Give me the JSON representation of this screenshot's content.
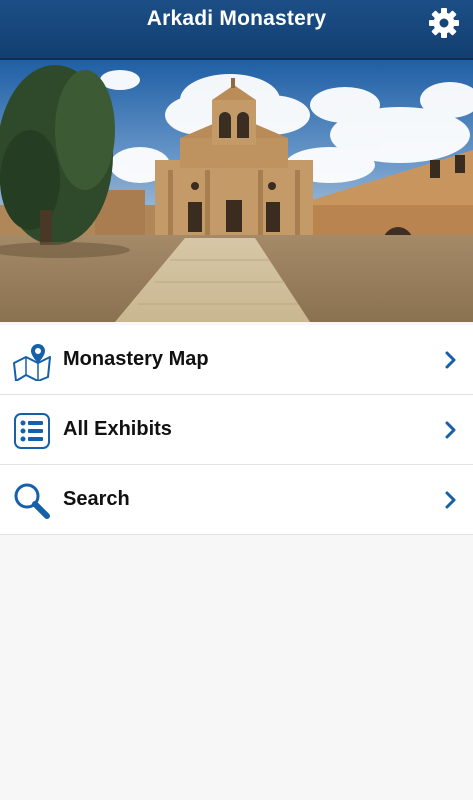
{
  "header": {
    "title": "Arkadi Monastery",
    "settings_icon": "gear-icon"
  },
  "hero": {
    "image_subject": "Arkadi Monastery church facade under blue sky with clouds, cypress tree and courtyard"
  },
  "menu": {
    "items": [
      {
        "label": "Monastery Map",
        "icon": "map-pin-icon"
      },
      {
        "label": "All Exhibits",
        "icon": "list-icon"
      },
      {
        "label": "Search",
        "icon": "search-icon"
      }
    ]
  },
  "colors": {
    "header_bg": "#1a4a80",
    "accent_blue": "#1560a8",
    "page_bg": "#f7f7f7"
  }
}
